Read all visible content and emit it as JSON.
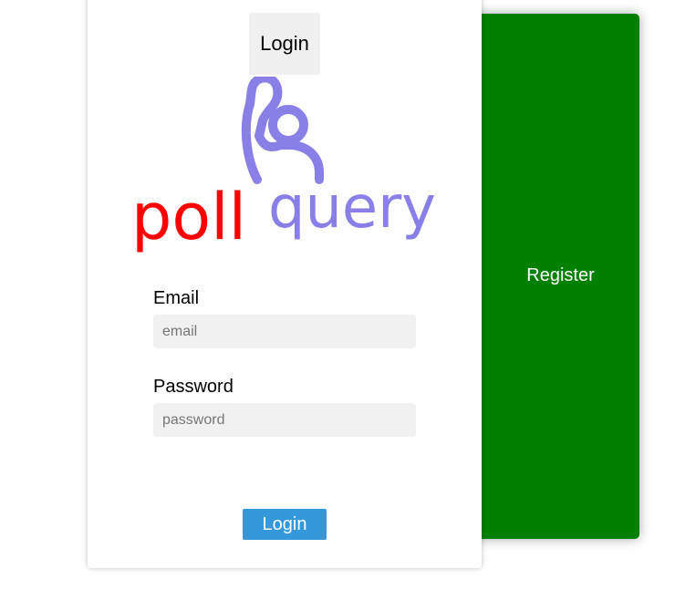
{
  "register_panel": {
    "label": "Register",
    "color": "#008000"
  },
  "login_card": {
    "tab_label": "Login",
    "logo": {
      "word_poll": "poll",
      "word_query": "query",
      "poll_color": "#ff0000",
      "query_color": "#8880e6"
    },
    "email": {
      "label": "Email",
      "placeholder": "email",
      "value": ""
    },
    "password": {
      "label": "Password",
      "placeholder": "password",
      "value": ""
    },
    "submit_label": "Login",
    "submit_color": "#3498db"
  }
}
